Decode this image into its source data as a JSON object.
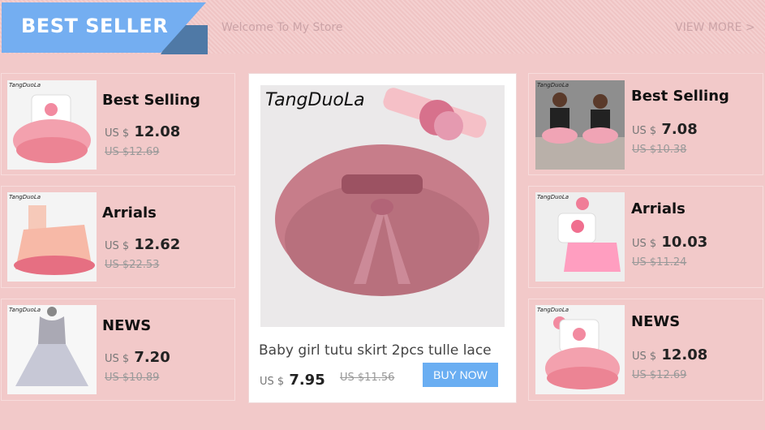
{
  "header": {
    "badge": "BEST SELLER",
    "welcome": "Welcome To My Store",
    "view_more": "VIEW MORE >"
  },
  "left_cards": [
    {
      "title": "Best Selling",
      "currency": "US $",
      "price": "12.08",
      "old_price": "US $12.69",
      "brand": "TangDuoLa"
    },
    {
      "title": "Arrials",
      "currency": "US $",
      "price": "12.62",
      "old_price": "US $22.53",
      "brand": "TangDuoLa"
    },
    {
      "title": "NEWS",
      "currency": "US $",
      "price": "7.20",
      "old_price": "US $10.89",
      "brand": "TangDuoLa"
    }
  ],
  "center": {
    "brand": "TangDuoLa",
    "name": "Baby girl tutu skirt 2pcs tulle lace",
    "currency": "US $",
    "price": "7.95",
    "old_price": "US $11.56",
    "button": "BUY NOW"
  },
  "right_cards": [
    {
      "title": "Best Selling",
      "currency": "US $",
      "price": "7.08",
      "old_price": "US $10.38",
      "brand": "TangDuoLa"
    },
    {
      "title": "Arrials",
      "currency": "US $",
      "price": "10.03",
      "old_price": "US $11.24",
      "brand": "TangDuoLa"
    },
    {
      "title": "NEWS",
      "currency": "US $",
      "price": "12.08",
      "old_price": "US $12.69",
      "brand": "TangDuoLa"
    }
  ],
  "colors": {
    "accent": "#74aef1",
    "dark_accent": "#4f79a6",
    "background": "#f2c9c9"
  }
}
